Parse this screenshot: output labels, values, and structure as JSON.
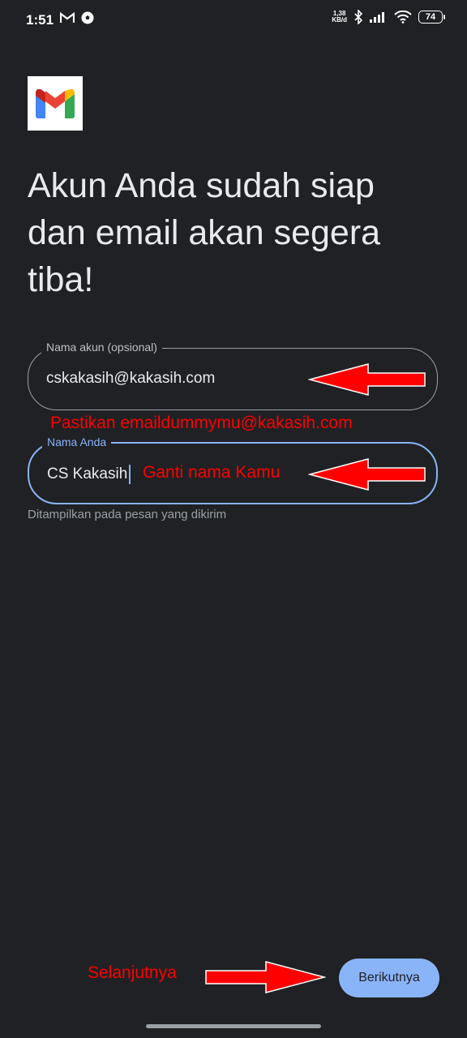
{
  "status_bar": {
    "time": "1:51",
    "speed_value": "1,38",
    "speed_unit": "KB/d",
    "battery": "74"
  },
  "heading": "Akun Anda sudah siap dan email akan segera tiba!",
  "field_account": {
    "label": "Nama akun (opsional)",
    "value": "cskakasih@kakasih.com"
  },
  "field_name": {
    "label": "Nama Anda",
    "value": "CS Kakasih"
  },
  "helper_text": "Ditampilkan pada pesan yang dikirim",
  "annotations": {
    "account_note": "Pastikan emaildummymu@kakasih.com",
    "name_note": "Ganti nama Kamu",
    "next_note": "Selanjutnya"
  },
  "next_button": "Berikutnya",
  "colors": {
    "background": "#202124",
    "accent": "#8ab4f8",
    "annotation": "#ff0000"
  }
}
